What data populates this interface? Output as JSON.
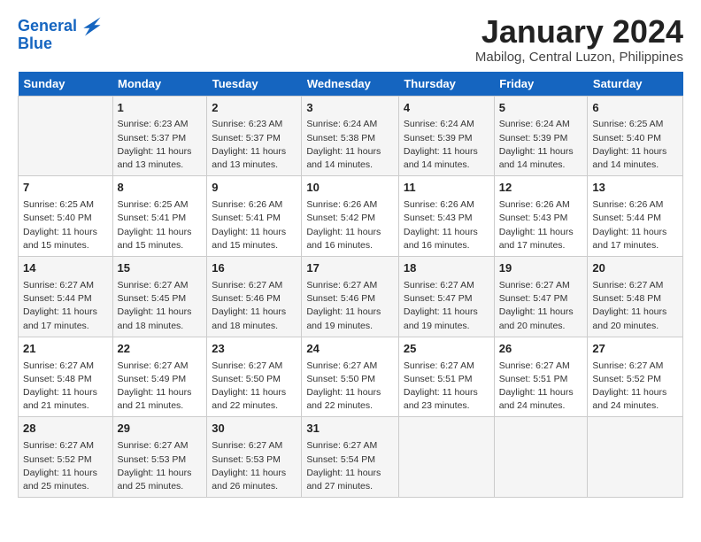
{
  "header": {
    "logo_line1": "General",
    "logo_line2": "Blue",
    "month": "January 2024",
    "location": "Mabilog, Central Luzon, Philippines"
  },
  "days_of_week": [
    "Sunday",
    "Monday",
    "Tuesday",
    "Wednesday",
    "Thursday",
    "Friday",
    "Saturday"
  ],
  "weeks": [
    [
      {
        "day": "",
        "info": ""
      },
      {
        "day": "1",
        "info": "Sunrise: 6:23 AM\nSunset: 5:37 PM\nDaylight: 11 hours\nand 13 minutes."
      },
      {
        "day": "2",
        "info": "Sunrise: 6:23 AM\nSunset: 5:37 PM\nDaylight: 11 hours\nand 13 minutes."
      },
      {
        "day": "3",
        "info": "Sunrise: 6:24 AM\nSunset: 5:38 PM\nDaylight: 11 hours\nand 14 minutes."
      },
      {
        "day": "4",
        "info": "Sunrise: 6:24 AM\nSunset: 5:39 PM\nDaylight: 11 hours\nand 14 minutes."
      },
      {
        "day": "5",
        "info": "Sunrise: 6:24 AM\nSunset: 5:39 PM\nDaylight: 11 hours\nand 14 minutes."
      },
      {
        "day": "6",
        "info": "Sunrise: 6:25 AM\nSunset: 5:40 PM\nDaylight: 11 hours\nand 14 minutes."
      }
    ],
    [
      {
        "day": "7",
        "info": "Sunrise: 6:25 AM\nSunset: 5:40 PM\nDaylight: 11 hours\nand 15 minutes."
      },
      {
        "day": "8",
        "info": "Sunrise: 6:25 AM\nSunset: 5:41 PM\nDaylight: 11 hours\nand 15 minutes."
      },
      {
        "day": "9",
        "info": "Sunrise: 6:26 AM\nSunset: 5:41 PM\nDaylight: 11 hours\nand 15 minutes."
      },
      {
        "day": "10",
        "info": "Sunrise: 6:26 AM\nSunset: 5:42 PM\nDaylight: 11 hours\nand 16 minutes."
      },
      {
        "day": "11",
        "info": "Sunrise: 6:26 AM\nSunset: 5:43 PM\nDaylight: 11 hours\nand 16 minutes."
      },
      {
        "day": "12",
        "info": "Sunrise: 6:26 AM\nSunset: 5:43 PM\nDaylight: 11 hours\nand 17 minutes."
      },
      {
        "day": "13",
        "info": "Sunrise: 6:26 AM\nSunset: 5:44 PM\nDaylight: 11 hours\nand 17 minutes."
      }
    ],
    [
      {
        "day": "14",
        "info": "Sunrise: 6:27 AM\nSunset: 5:44 PM\nDaylight: 11 hours\nand 17 minutes."
      },
      {
        "day": "15",
        "info": "Sunrise: 6:27 AM\nSunset: 5:45 PM\nDaylight: 11 hours\nand 18 minutes."
      },
      {
        "day": "16",
        "info": "Sunrise: 6:27 AM\nSunset: 5:46 PM\nDaylight: 11 hours\nand 18 minutes."
      },
      {
        "day": "17",
        "info": "Sunrise: 6:27 AM\nSunset: 5:46 PM\nDaylight: 11 hours\nand 19 minutes."
      },
      {
        "day": "18",
        "info": "Sunrise: 6:27 AM\nSunset: 5:47 PM\nDaylight: 11 hours\nand 19 minutes."
      },
      {
        "day": "19",
        "info": "Sunrise: 6:27 AM\nSunset: 5:47 PM\nDaylight: 11 hours\nand 20 minutes."
      },
      {
        "day": "20",
        "info": "Sunrise: 6:27 AM\nSunset: 5:48 PM\nDaylight: 11 hours\nand 20 minutes."
      }
    ],
    [
      {
        "day": "21",
        "info": "Sunrise: 6:27 AM\nSunset: 5:48 PM\nDaylight: 11 hours\nand 21 minutes."
      },
      {
        "day": "22",
        "info": "Sunrise: 6:27 AM\nSunset: 5:49 PM\nDaylight: 11 hours\nand 21 minutes."
      },
      {
        "day": "23",
        "info": "Sunrise: 6:27 AM\nSunset: 5:50 PM\nDaylight: 11 hours\nand 22 minutes."
      },
      {
        "day": "24",
        "info": "Sunrise: 6:27 AM\nSunset: 5:50 PM\nDaylight: 11 hours\nand 22 minutes."
      },
      {
        "day": "25",
        "info": "Sunrise: 6:27 AM\nSunset: 5:51 PM\nDaylight: 11 hours\nand 23 minutes."
      },
      {
        "day": "26",
        "info": "Sunrise: 6:27 AM\nSunset: 5:51 PM\nDaylight: 11 hours\nand 24 minutes."
      },
      {
        "day": "27",
        "info": "Sunrise: 6:27 AM\nSunset: 5:52 PM\nDaylight: 11 hours\nand 24 minutes."
      }
    ],
    [
      {
        "day": "28",
        "info": "Sunrise: 6:27 AM\nSunset: 5:52 PM\nDaylight: 11 hours\nand 25 minutes."
      },
      {
        "day": "29",
        "info": "Sunrise: 6:27 AM\nSunset: 5:53 PM\nDaylight: 11 hours\nand 25 minutes."
      },
      {
        "day": "30",
        "info": "Sunrise: 6:27 AM\nSunset: 5:53 PM\nDaylight: 11 hours\nand 26 minutes."
      },
      {
        "day": "31",
        "info": "Sunrise: 6:27 AM\nSunset: 5:54 PM\nDaylight: 11 hours\nand 27 minutes."
      },
      {
        "day": "",
        "info": ""
      },
      {
        "day": "",
        "info": ""
      },
      {
        "day": "",
        "info": ""
      }
    ]
  ]
}
